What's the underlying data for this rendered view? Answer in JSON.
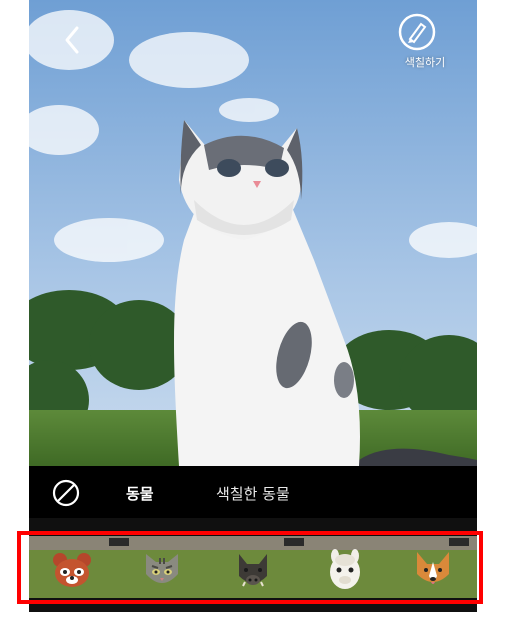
{
  "header": {
    "back_icon": "chevron-left-icon",
    "paint_button_label": "색칠하기",
    "paint_icon": "brush-circle-icon"
  },
  "tabs": {
    "none_icon": "no-filter-icon",
    "items": [
      {
        "label": "동물",
        "active": true
      },
      {
        "label": "색칠한 동물",
        "active": false
      }
    ]
  },
  "stickers": [
    {
      "name": "red-panda",
      "icon": "red-panda-face-icon"
    },
    {
      "name": "tabby-cat",
      "icon": "tabby-cat-face-icon"
    },
    {
      "name": "wild-boar",
      "icon": "wild-boar-face-icon"
    },
    {
      "name": "alpaca",
      "icon": "alpaca-face-icon"
    },
    {
      "name": "corgi",
      "icon": "corgi-face-icon"
    }
  ],
  "colors": {
    "highlight": "#ff0000",
    "tabbar_bg": "#000000",
    "text": "#ffffff"
  }
}
